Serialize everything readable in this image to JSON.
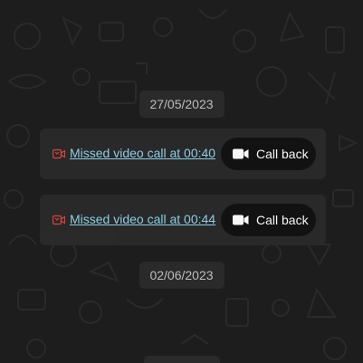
{
  "conversation": {
    "date_separators": [
      "27/05/2023",
      "02/06/2023",
      ""
    ],
    "calls": [
      {
        "link_text": "Missed video call at 00:40",
        "button_label": "Call back",
        "status_icon": "missed-video-call-icon",
        "button_icon": "video-camera-icon"
      },
      {
        "link_text": "Missed video call at 00:44",
        "button_label": "Call back",
        "status_icon": "missed-video-call-icon",
        "button_icon": "video-camera-icon"
      }
    ]
  },
  "colors": {
    "background": "#1d1d1d",
    "bubble": "#2a2a2a",
    "link": "#8fd3ee",
    "missed": "#e0443d",
    "button": "#121212",
    "date_text": "#bdbdbd"
  }
}
